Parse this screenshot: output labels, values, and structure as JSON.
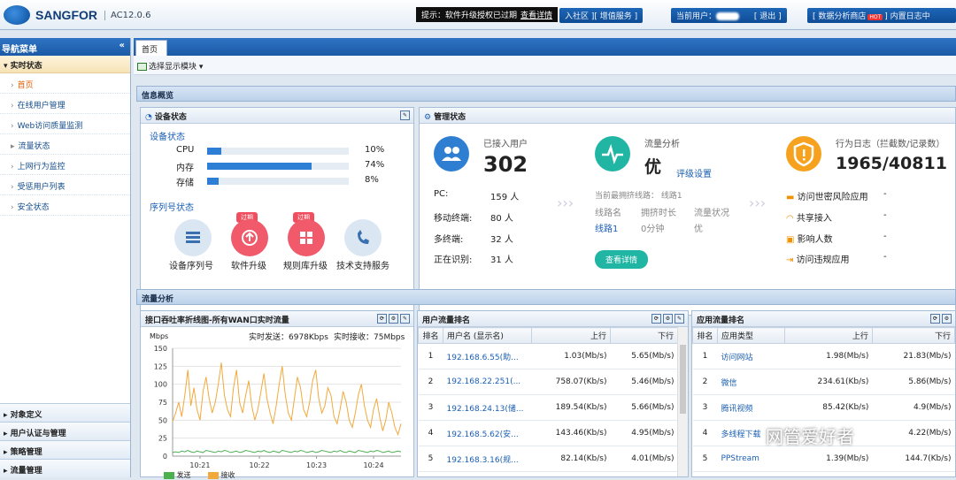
{
  "header": {
    "brand": "SANGFOR",
    "version": "AC12.0.6",
    "notice": "提示：软件升级授权已过期",
    "notice_link": "查看详情",
    "community_links": "入社区 ][ 增值服务 ]",
    "current_user_label": "当前用户：",
    "logout": "[ 退出 ]",
    "data_store": "[ 数据分析商店",
    "hot": "HOT",
    "builtin_log": "] 内置日志中"
  },
  "sidebar": {
    "title": "导航菜单",
    "collapse": "«",
    "section": "▾ 实时状态",
    "items": [
      {
        "label": "首页"
      },
      {
        "label": "在线用户管理"
      },
      {
        "label": "Web访问质量监测"
      },
      {
        "label": "流量状态"
      },
      {
        "label": "上网行为监控"
      },
      {
        "label": "受惩用户列表"
      },
      {
        "label": "安全状态"
      }
    ],
    "groups": [
      {
        "label": "▸ 对象定义"
      },
      {
        "label": "▸ 用户认证与管理"
      },
      {
        "label": "▸ 策略管理"
      },
      {
        "label": "▸ 流量管理"
      }
    ]
  },
  "tabs": {
    "home": "首页"
  },
  "toolbar": {
    "select_module": "选择显示模块 ▾"
  },
  "sections": {
    "info": "信息概览",
    "traffic": "流量分析"
  },
  "device": {
    "title": "设备状态",
    "subtitle": "设备状态",
    "cpu": {
      "label": "CPU",
      "value": "10%",
      "pct": 10
    },
    "mem": {
      "label": "内存",
      "value": "74%",
      "pct": 74
    },
    "disk": {
      "label": "存储",
      "value": "8%",
      "pct": 8
    },
    "serial_title": "序列号状态",
    "icons": [
      {
        "label": "设备序列号",
        "badge": ""
      },
      {
        "label": "软件升级",
        "badge": "过期"
      },
      {
        "label": "规则库升级",
        "badge": "过期"
      },
      {
        "label": "技术支持服务",
        "badge": ""
      }
    ]
  },
  "mgmt": {
    "title": "管理状态",
    "users_label": "已接入用户",
    "users_count": "302",
    "pc_label": "PC:",
    "pc_value": "159 人",
    "mobile_label": "移动终端:",
    "mobile_value": "80 人",
    "multi_label": "多终端:",
    "multi_value": "32 人",
    "identifying_label": "正在识别:",
    "identifying_value": "31 人",
    "flow_label": "流量分析",
    "flow_grade": "优",
    "grade_settings": "评级设置",
    "congested_line": "当前最拥挤线路：  线路1",
    "line_name_h": "线路名",
    "congest_h": "拥挤时长",
    "status_h": "流量状况",
    "line_name": "线路1",
    "congest_time": "0分钟",
    "status": "优",
    "view_details": "查看详情",
    "log_label": "行为日志（拦截数/记录数）",
    "log_count": "1965/40811",
    "risk_label": "访问世密风险应用",
    "risk_value": "-",
    "share_label": "共享接入",
    "share_value": "-",
    "affected_label": "影响人数",
    "affected_value": "-",
    "violation_label": "访问违规应用",
    "violation_value": "-"
  },
  "chart_panel": {
    "title": "接口吞吐率折线图-所有WAN口实时流量",
    "send_rt": "实时发送：6978Kbps",
    "recv_rt": "实时接收：75Mbps",
    "legend_send": "发送",
    "legend_recv": "接收"
  },
  "chart_data": {
    "type": "line",
    "ylabel": "Mbps",
    "ylim": [
      0,
      150
    ],
    "yticks": [
      "0",
      "25",
      "50",
      "75",
      "100",
      "125",
      "150"
    ],
    "xticks": [
      {
        "label": "10:21",
        "t": 0.12
      },
      {
        "label": "10:22",
        "t": 0.38
      },
      {
        "label": "10:23",
        "t": 0.63
      },
      {
        "label": "10:24",
        "t": 0.88
      }
    ],
    "series": [
      {
        "name": "接收",
        "color": "#f2a93b",
        "values": [
          48,
          60,
          75,
          55,
          85,
          120,
          70,
          95,
          65,
          50,
          90,
          110,
          80,
          60,
          75,
          100,
          130,
          85,
          65,
          55,
          95,
          120,
          75,
          60,
          85,
          105,
          70,
          50,
          65,
          90,
          115,
          80,
          60,
          45,
          70,
          100,
          125,
          85,
          60,
          50,
          80,
          110,
          95,
          65,
          55,
          75,
          105,
          120,
          80,
          60,
          70,
          95,
          85,
          55,
          45,
          65,
          90,
          75,
          50,
          40,
          60,
          85,
          100,
          70,
          50,
          40,
          65,
          80,
          55,
          35,
          50,
          75,
          60,
          40,
          30,
          45
        ]
      },
      {
        "name": "发送",
        "color": "#4caf50",
        "values": [
          5,
          6,
          5,
          7,
          6,
          8,
          6,
          5,
          7,
          6,
          5,
          8,
          7,
          6,
          5,
          7,
          6,
          8,
          7,
          5,
          6,
          7,
          5,
          6,
          8,
          7,
          6,
          5,
          7,
          6,
          8,
          6,
          5,
          7,
          6,
          5,
          8,
          7,
          6,
          5,
          7,
          6,
          8,
          7,
          5,
          6,
          7,
          5,
          6,
          8,
          7,
          6,
          5,
          7,
          6,
          8,
          6,
          5,
          7,
          6,
          5,
          8,
          7,
          6,
          5,
          7,
          6,
          8,
          7,
          5,
          6,
          7,
          5,
          6,
          7,
          6
        ]
      }
    ]
  },
  "user_rank": {
    "title": "用户流量排名",
    "cols": [
      "排名",
      "用户名 (显示名)",
      "上行",
      "下行"
    ],
    "rows": [
      [
        "1",
        "192.168.6.55(助...",
        "1.03(Mb/s)",
        "5.65(Mb/s)"
      ],
      [
        "2",
        "192.168.22.251(...",
        "758.07(Kb/s)",
        "5.46(Mb/s)"
      ],
      [
        "3",
        "192.168.24.13(储...",
        "189.54(Kb/s)",
        "5.66(Mb/s)"
      ],
      [
        "4",
        "192.168.5.62(安...",
        "143.46(Kb/s)",
        "4.95(Mb/s)"
      ],
      [
        "5",
        "192.168.3.16(规...",
        "82.14(Kb/s)",
        "4.01(Mb/s)"
      ]
    ]
  },
  "app_rank": {
    "title": "应用流量排名",
    "cols": [
      "排名",
      "应用类型",
      "上行",
      "下行"
    ],
    "rows": [
      [
        "1",
        "访问网站",
        "1.98(Mb/s)",
        "21.83(Mb/s)"
      ],
      [
        "2",
        "微信",
        "234.61(Kb/s)",
        "5.86(Mb/s)"
      ],
      [
        "3",
        "腾讯视频",
        "85.42(Kb/s)",
        "4.9(Mb/s)"
      ],
      [
        "4",
        "多线程下载",
        "",
        "4.22(Mb/s)"
      ],
      [
        "5",
        "PPStream",
        "1.39(Mb/s)",
        "144.7(Kb/s)"
      ]
    ]
  },
  "watermark": "网管爱好者"
}
